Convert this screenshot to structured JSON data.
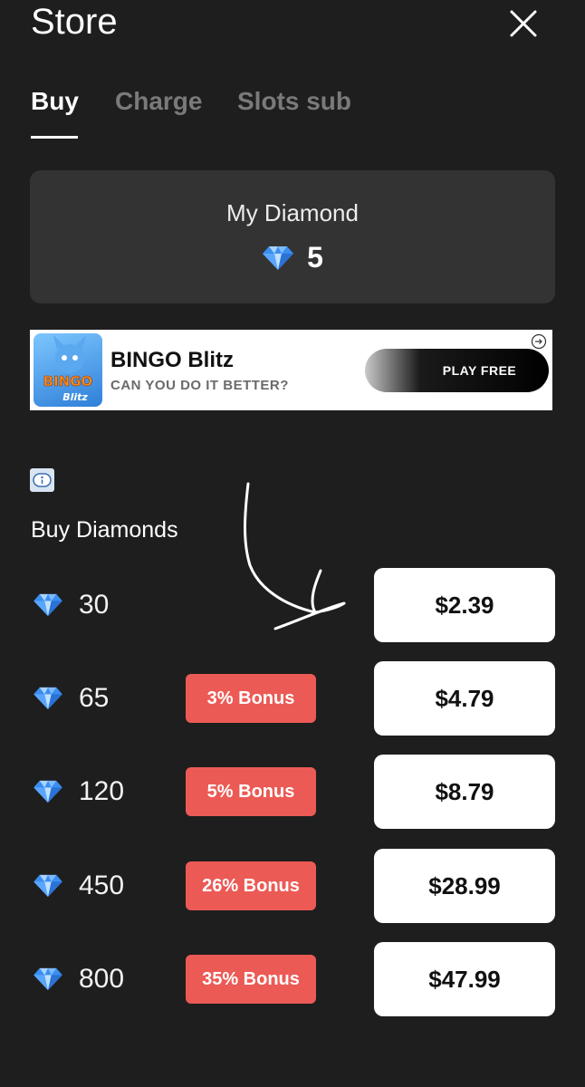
{
  "header": {
    "title": "Store"
  },
  "tabs": [
    {
      "label": "Buy",
      "active": true
    },
    {
      "label": "Charge",
      "active": false
    },
    {
      "label": "Slots sub",
      "active": false
    }
  ],
  "balance": {
    "label": "My Diamond",
    "value": "5"
  },
  "ad": {
    "title": "BINGO Blitz",
    "subtitle": "CAN YOU DO IT BETTER?",
    "cta": "PLAY FREE",
    "logo_text_1": "BINGO",
    "logo_text_2": "Blitz"
  },
  "section": {
    "title": "Buy Diamonds"
  },
  "packages": [
    {
      "amount": "30",
      "bonus": "",
      "price": "$2.39"
    },
    {
      "amount": "65",
      "bonus": "3% Bonus",
      "price": "$4.79"
    },
    {
      "amount": "120",
      "bonus": "5% Bonus",
      "price": "$8.79"
    },
    {
      "amount": "450",
      "bonus": "26% Bonus",
      "price": "$28.99"
    },
    {
      "amount": "800",
      "bonus": "35% Bonus",
      "price": "$47.99"
    }
  ],
  "colors": {
    "background": "#1e1e1e",
    "card": "#333333",
    "bonus_badge": "#ec5a55",
    "price_button": "#ffffff",
    "gem": "#3a8ef0"
  },
  "icons": [
    "close-icon",
    "diamond-icon",
    "info-icon",
    "ad-choices-icon"
  ]
}
